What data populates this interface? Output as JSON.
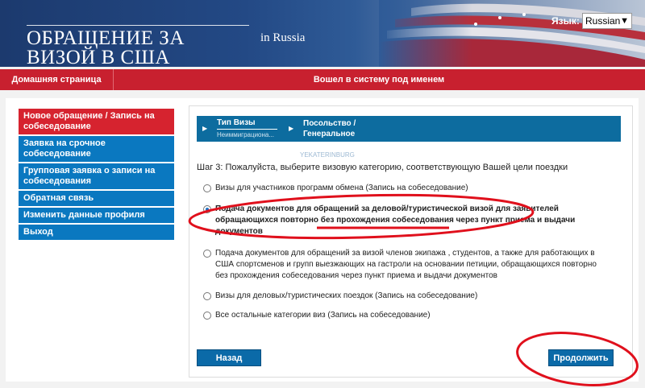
{
  "header": {
    "title": "ОБРАЩЕНИЕ ЗА\nВИЗОЙ В США",
    "subtitle": "in Russia",
    "language_label": "Язык:",
    "language_value": "Russian"
  },
  "navbar": {
    "home": "Домашняя страница",
    "logged_in": "Вошел в систему под именем"
  },
  "sidebar": {
    "items": [
      {
        "label": "Новое обращение / Запись на собеседование",
        "active": true
      },
      {
        "label": "Заявка на срочное собеседование"
      },
      {
        "label": "Групповая заявка о записи на собеседования"
      },
      {
        "label": "Обратная связь"
      },
      {
        "label": "Изменить данные профиля"
      },
      {
        "label": "Выход"
      }
    ]
  },
  "steps": {
    "step1_title": "Тип Визы",
    "step1_sub": "Неиммиграциона...",
    "step2_title": "Посольство /\nГенеральное",
    "watermark": "YEKATERINBURG"
  },
  "form": {
    "step_label": "Шаг 3:",
    "step_text": " Пожалуйста, выберите визовую категорию, соответствующую Вашей цели поездки",
    "options": [
      {
        "label": "Визы для участников программ обмена (Запись на собеседование)"
      },
      {
        "label": "Подача документов для обращений за деловой/туристической визой для заявителей обращающихся повторно без прохождения собеседования через пункт приема и выдачи документов",
        "selected": true
      },
      {
        "label": "Подача документов для обращений за визой членов экипажа , студентов, а также для работающих в США спортсменов и групп выезжающих на гастроли на основании петиции, обращающихся повторно без прохождения собеседования через пункт приема и выдачи документов"
      },
      {
        "label": "Визы для деловых/туристических поездок (Запись на собеседование)"
      },
      {
        "label": "Все остальные категории виз (Запись на собеседование)"
      }
    ],
    "back_label": "Назад",
    "next_label": "Продолжить"
  },
  "colors": {
    "nav_red": "#c8202f",
    "accent_blue": "#0a78c0",
    "annotation_red": "#e0101c"
  }
}
